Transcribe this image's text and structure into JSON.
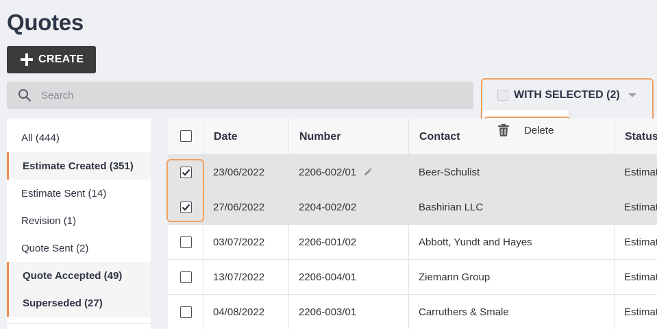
{
  "page": {
    "title": "Quotes"
  },
  "toolbar": {
    "create_label": "CREATE"
  },
  "search": {
    "placeholder": "Search"
  },
  "bulk": {
    "with_selected_label": "WITH SELECTED (2)",
    "delete_label": "Delete"
  },
  "sidebar": {
    "items": [
      {
        "label": "All (444)",
        "bold": false
      },
      {
        "label": "Estimate Created (351)",
        "bold": true
      },
      {
        "label": "Estimate Sent (14)",
        "bold": false
      },
      {
        "label": "Revision (1)",
        "bold": false
      },
      {
        "label": "Quote Sent (2)",
        "bold": false
      },
      {
        "label": "Quote Accepted (49)",
        "bold": true
      },
      {
        "label": "Superseded (27)",
        "bold": true
      }
    ]
  },
  "table": {
    "headers": {
      "date": "Date",
      "number": "Number",
      "contact": "Contact",
      "status": "Status"
    },
    "rows": [
      {
        "date": "23/06/2022",
        "number": "2206-002/01",
        "contact": "Beer-Schulist",
        "status": "Estimate Created",
        "checked": true
      },
      {
        "date": "27/06/2022",
        "number": "2204-002/02",
        "contact": "Bashirian LLC",
        "status": "Estimate Created",
        "checked": true
      },
      {
        "date": "03/07/2022",
        "number": "2206-001/02",
        "contact": "Abbott, Yundt and Hayes",
        "status": "Estimate Created",
        "checked": false
      },
      {
        "date": "13/07/2022",
        "number": "2206-004/01",
        "contact": "Ziemann Group",
        "status": "Estimate Created",
        "checked": false
      },
      {
        "date": "04/08/2022",
        "number": "2206-003/01",
        "contact": "Carruthers & Smale",
        "status": "Estimate Created",
        "checked": false
      }
    ]
  },
  "colors": {
    "accent": "#f0a062",
    "sidebar_marker": "#e98b4a",
    "dark_button": "#3a3b3c"
  }
}
